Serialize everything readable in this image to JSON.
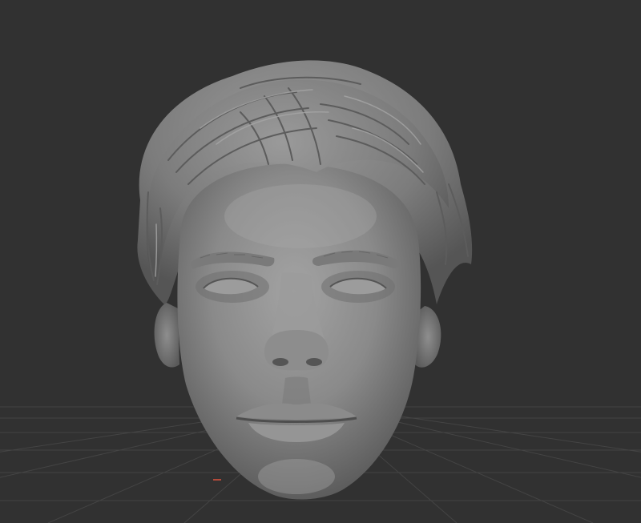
{
  "viewport": {
    "background_color": "#313131",
    "grid_visible": true,
    "grid_color": "#444444",
    "model": {
      "type": "sculpted-head",
      "material_color": "#8a8a8a",
      "shading": "clay"
    },
    "axis_marker_color": "#b34a3a"
  }
}
